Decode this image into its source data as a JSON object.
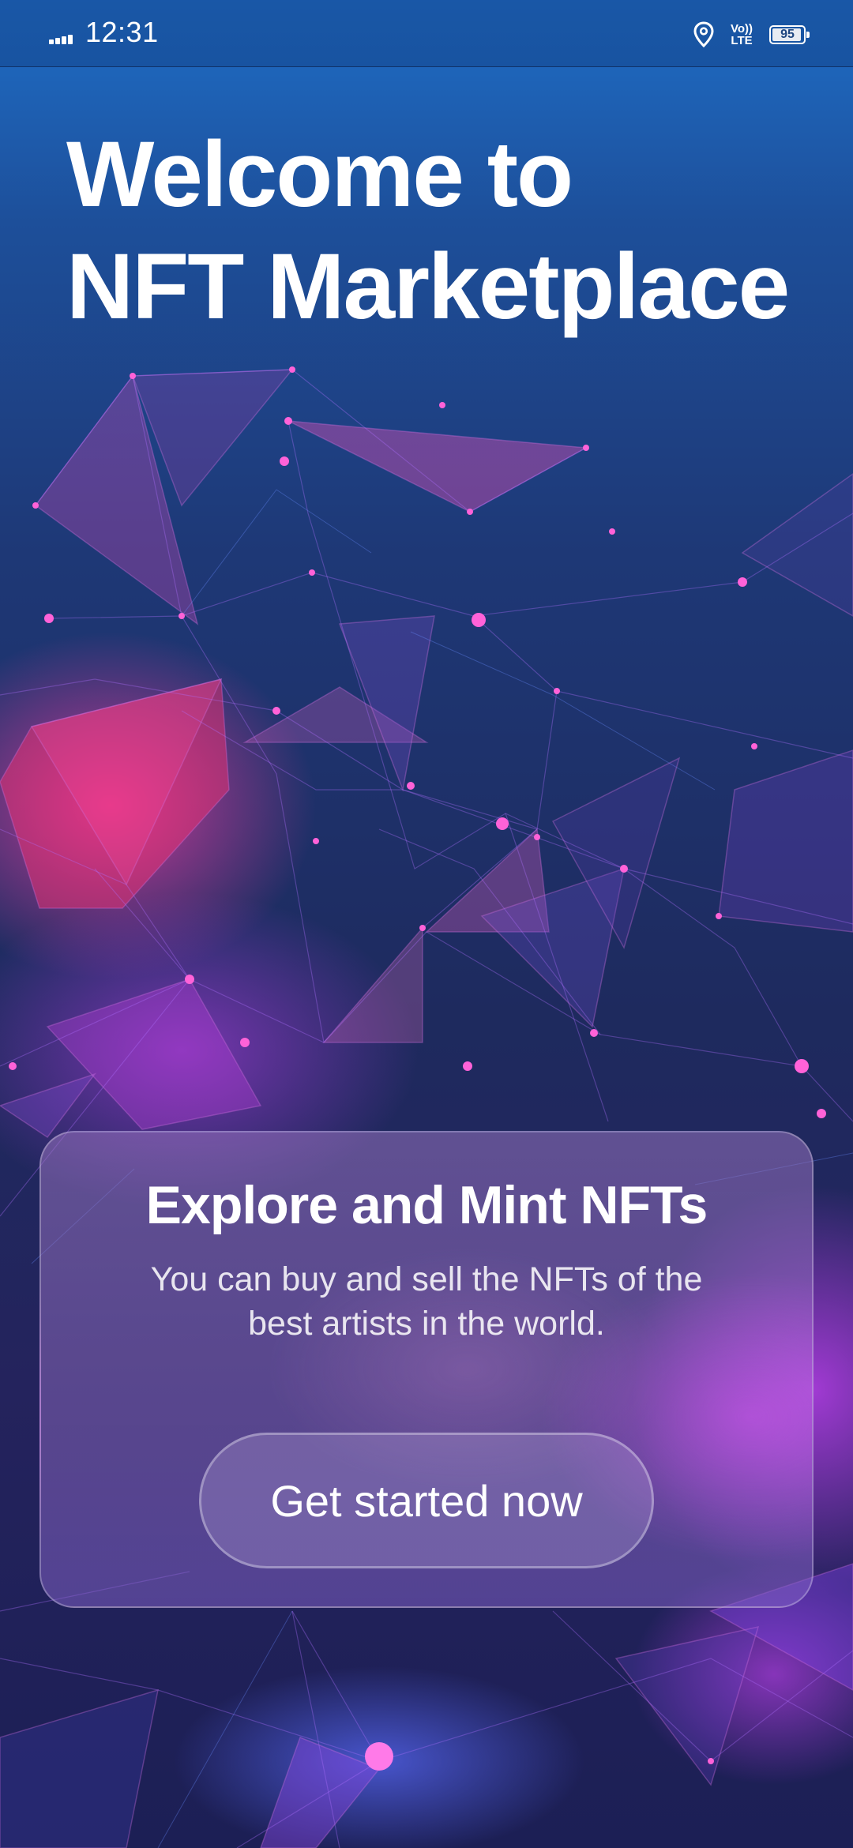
{
  "status_bar": {
    "time": "12:31",
    "network_label_top": "Vo))",
    "network_label_bottom": "LTE",
    "battery_level": "95",
    "icons": [
      "signal-icon",
      "location-icon",
      "volte-icon",
      "battery-icon"
    ]
  },
  "welcome": {
    "line1": "Welcome to",
    "line2": "NFT Marketplace"
  },
  "card": {
    "title": "Explore and Mint NFTs",
    "description": "You can buy and sell the NFTs of the best artists in the world.",
    "cta_label": "Get started now"
  },
  "colors": {
    "background_top": "#1f6ec7",
    "background_bottom": "#1c1f55",
    "accent_pink": "#e040c8",
    "accent_purple": "#9b4cf0",
    "text": "#ffffff"
  }
}
